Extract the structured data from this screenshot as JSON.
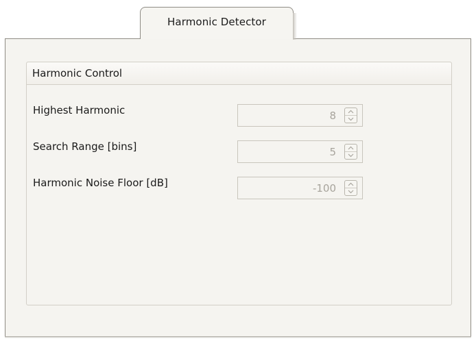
{
  "tabs": [
    {
      "label": "Harmonic Detector",
      "selected": true
    }
  ],
  "group": {
    "title": "Harmonic Control"
  },
  "fields": [
    {
      "label": "Highest Harmonic",
      "value": "8",
      "enabled": false
    },
    {
      "label": "Search Range [bins]",
      "value": "5",
      "enabled": false
    },
    {
      "label": "Harmonic Noise Floor [dB]",
      "value": "-100",
      "enabled": false
    }
  ],
  "icons": {
    "increment": "chevron-up-icon",
    "decrement": "chevron-down-icon"
  },
  "colors": {
    "panel_background": "#f5f4f0",
    "border": "#8e8b84",
    "disabled_text": "#a7a49c"
  }
}
